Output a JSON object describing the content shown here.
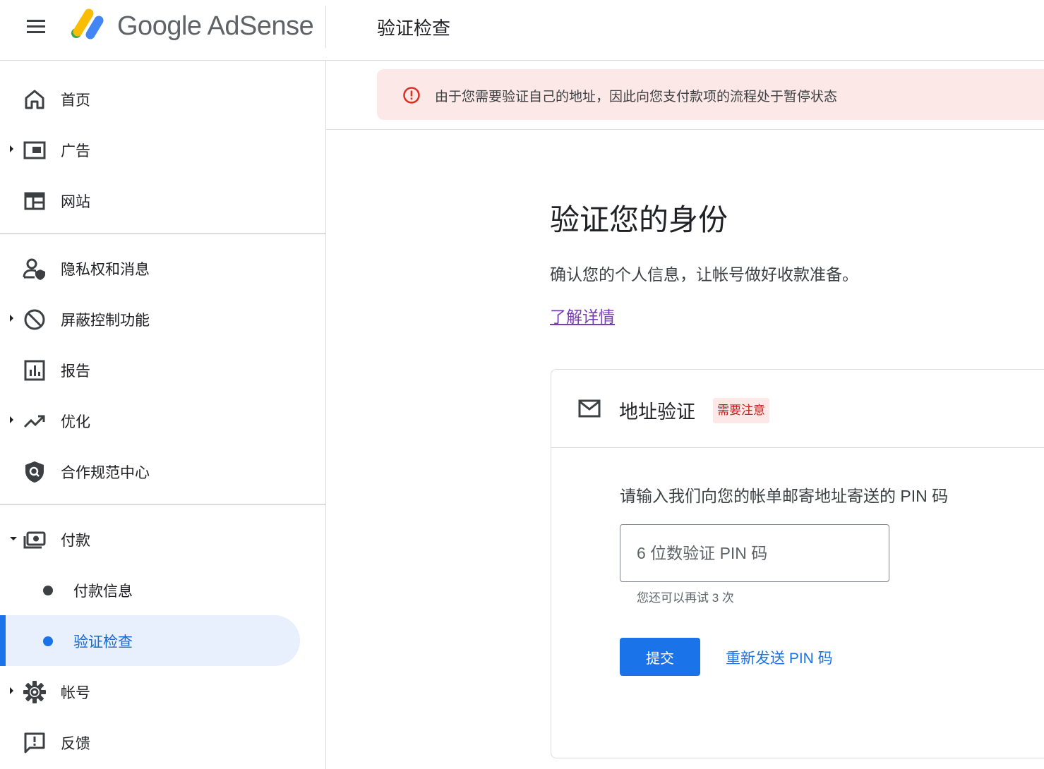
{
  "header": {
    "brand": "Google AdSense",
    "page_title": "验证检查"
  },
  "icons": {
    "menu": "menu-icon",
    "logo": "adsense-logo-icon"
  },
  "sidebar": {
    "items": [
      {
        "label": "首页",
        "icon": "home-icon"
      },
      {
        "label": "广告",
        "icon": "ads-icon",
        "expandable": true
      },
      {
        "label": "网站",
        "icon": "sites-icon"
      },
      {
        "label": "隐私权和消息",
        "icon": "privacy-icon"
      },
      {
        "label": "屏蔽控制功能",
        "icon": "block-icon",
        "expandable": true
      },
      {
        "label": "报告",
        "icon": "reports-icon"
      },
      {
        "label": "优化",
        "icon": "trending-icon",
        "expandable": true
      },
      {
        "label": "合作规范中心",
        "icon": "policy-icon"
      },
      {
        "label": "付款",
        "icon": "payments-icon",
        "expanded": true
      },
      {
        "label": "付款信息",
        "sub": true
      },
      {
        "label": "验证检查",
        "sub": true,
        "active": true
      },
      {
        "label": "帐号",
        "icon": "gear-icon",
        "expandable": true
      },
      {
        "label": "反馈",
        "icon": "feedback-icon"
      }
    ]
  },
  "alert": {
    "text": "由于您需要验证自己的地址，因此向您支付款项的流程处于暂停状态",
    "icon": "error-icon",
    "color": "#d93025"
  },
  "main": {
    "title": "验证您的身份",
    "subtitle": "确认您的个人信息，让帐号做好收款准备。",
    "learn_more": "了解详情"
  },
  "card": {
    "title": "地址验证",
    "badge": "需要注意",
    "icon": "mail-icon",
    "prompt": "请输入我们向您的帐单邮寄地址寄送的 PIN 码",
    "input_placeholder": "6 位数验证 PIN 码",
    "input_value": "",
    "hint": "您还可以再试 3 次",
    "submit_label": "提交",
    "resend_label": "重新发送 PIN 码"
  },
  "colors": {
    "accent": "#1a73e8",
    "alert_bg": "#fce8e6",
    "badge_text": "#c5221f",
    "link_visited": "#7b3fb5"
  }
}
